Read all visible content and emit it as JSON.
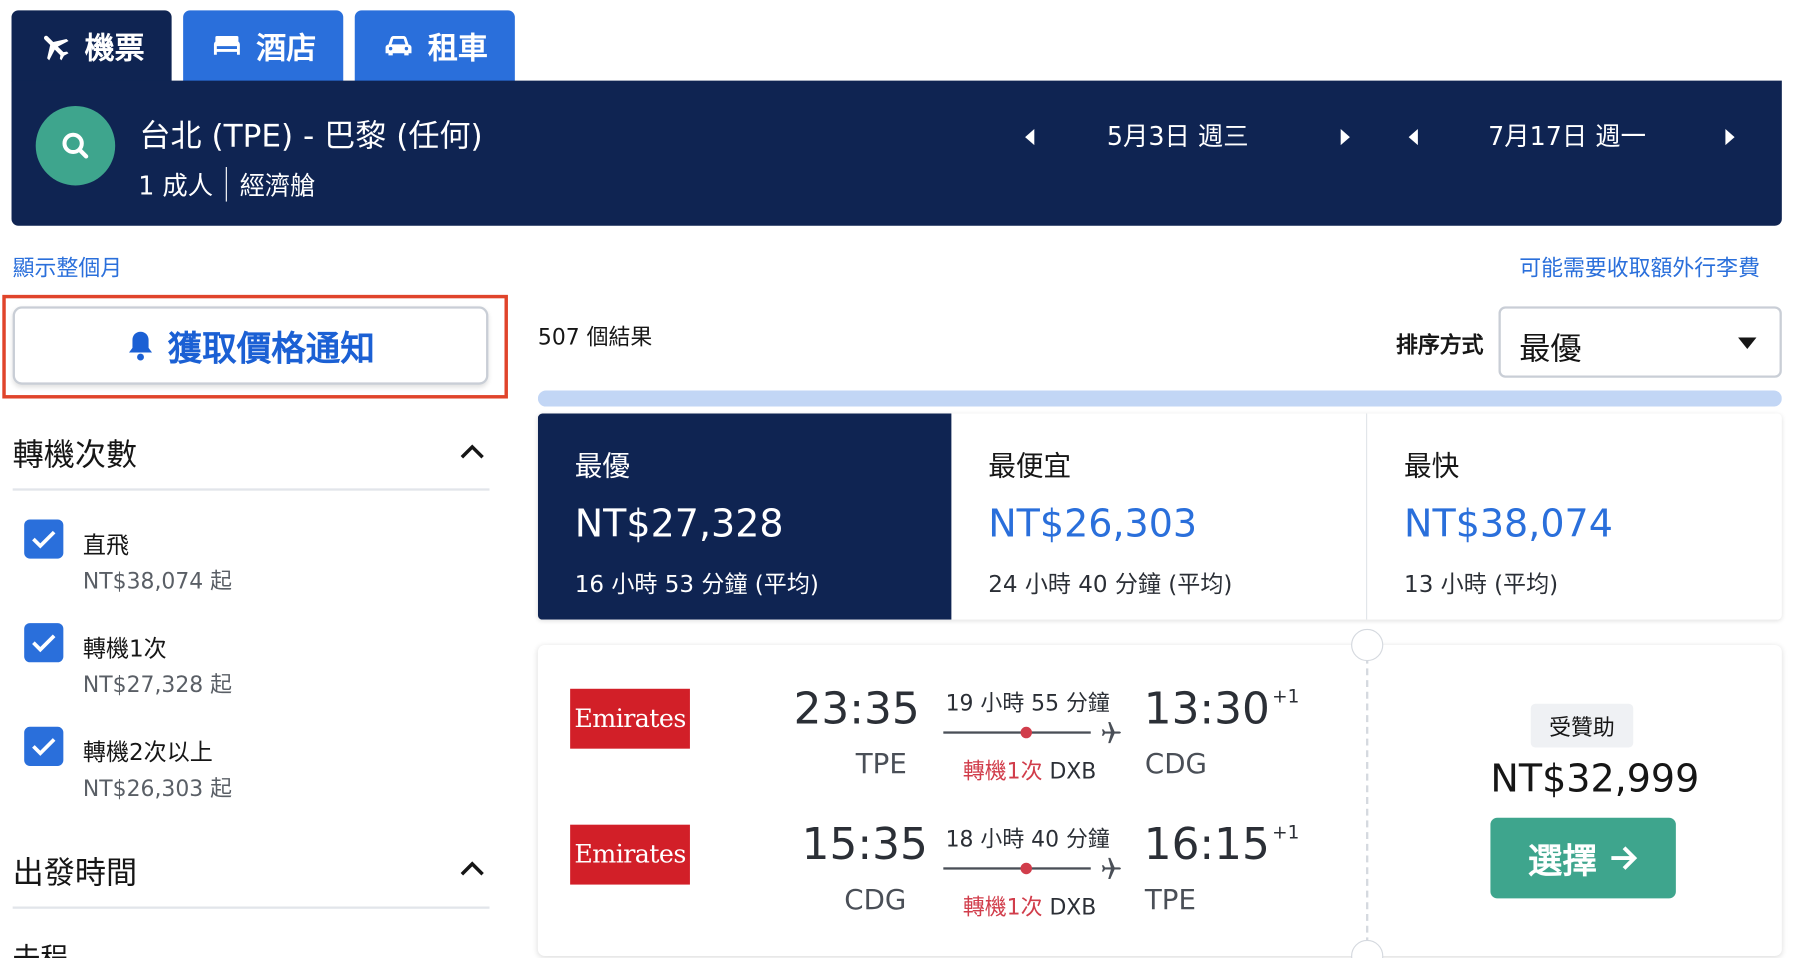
{
  "tabs": [
    {
      "label": "機票",
      "icon": "plane-icon",
      "active": true
    },
    {
      "label": "酒店",
      "icon": "bed-icon",
      "active": false
    },
    {
      "label": "租車",
      "icon": "car-icon",
      "active": false
    }
  ],
  "search": {
    "route": "台北 (TPE) - 巴黎 (任何)",
    "passengers": "1 成人",
    "cabin": "經濟艙",
    "depart_date": "5月3日 週三",
    "return_date": "7月17日 週一"
  },
  "links": {
    "show_month": "顯示整個月",
    "baggage_fee": "可能需要收取額外行李費"
  },
  "price_alert": {
    "label": "獲取價格通知",
    "icon": "bell-icon"
  },
  "filters": {
    "stops": {
      "title": "轉機次數",
      "options": [
        {
          "label": "直飛",
          "price": "NT$38,074 起",
          "checked": true
        },
        {
          "label": "轉機1次",
          "price": "NT$27,328 起",
          "checked": true
        },
        {
          "label": "轉機2次以上",
          "price": "NT$26,303 起",
          "checked": true
        }
      ]
    },
    "departure_time": {
      "title": "出發時間",
      "subtitle": "去程"
    }
  },
  "results": {
    "count": "507 個結果",
    "sort_label": "排序方式",
    "sort_value": "最優",
    "progress": 1.0
  },
  "sort_cards": [
    {
      "label": "最優",
      "price": "NT$27,328",
      "duration": "16 小時 53 分鐘 (平均)",
      "active": true
    },
    {
      "label": "最便宜",
      "price": "NT$26,303",
      "duration": "24 小時 40 分鐘 (平均)",
      "active": false
    },
    {
      "label": "最快",
      "price": "NT$38,074",
      "duration": "13 小時 (平均)",
      "active": false
    }
  ],
  "flight": {
    "legs": [
      {
        "airline": "Emirates",
        "depart_time": "23:35",
        "depart_code": "TPE",
        "duration": "19 小時 55 分鐘",
        "stops": "轉機1次",
        "via": "DXB",
        "arrive_time": "13:30",
        "day_offset": "+1",
        "arrive_code": "CDG"
      },
      {
        "airline": "Emirates",
        "depart_time": "15:35",
        "depart_code": "CDG",
        "duration": "18 小時 40 分鐘",
        "stops": "轉機1次",
        "via": "DXB",
        "arrive_time": "16:15",
        "day_offset": "+1",
        "arrive_code": "TPE"
      }
    ],
    "sponsored": "受贊助",
    "price": "NT$32,999",
    "select_label": "選擇"
  },
  "colors": {
    "navy": "#0f2452",
    "blue": "#2a6fdb",
    "green": "#3ea58d",
    "alert_outline": "#e0442b",
    "emirates_red": "#d21f28",
    "stop_red": "#d13d4b"
  }
}
